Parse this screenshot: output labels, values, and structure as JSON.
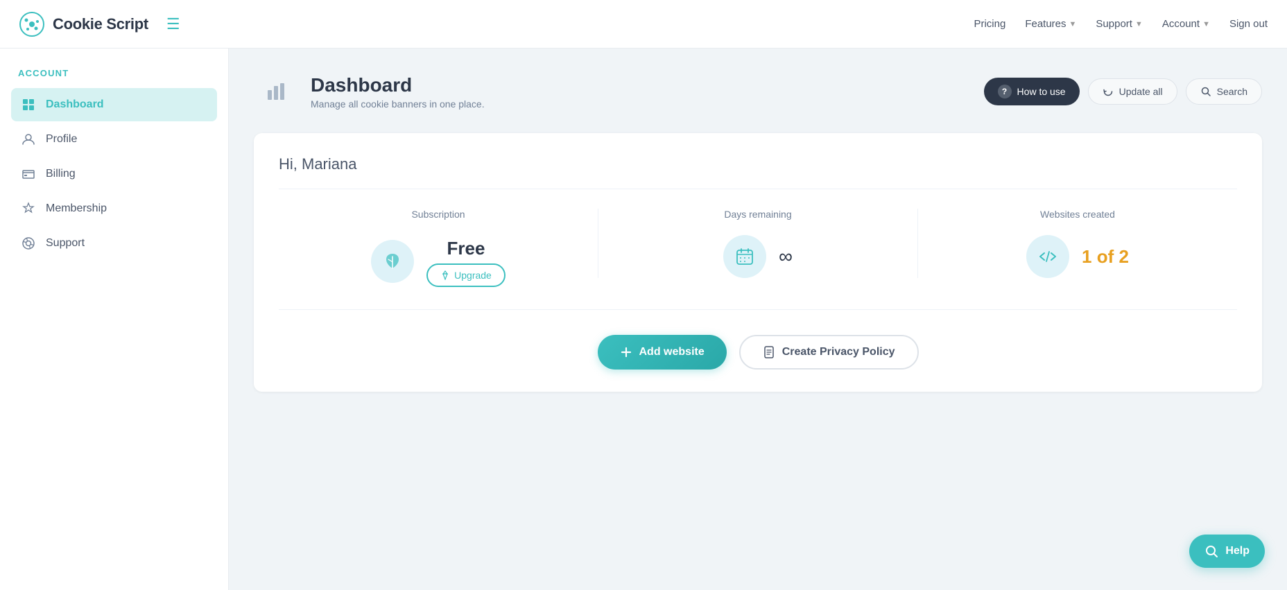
{
  "topnav": {
    "logo_text": "Cookie Script",
    "pricing": "Pricing",
    "features": "Features",
    "support": "Support",
    "account": "Account",
    "sign_out": "Sign out"
  },
  "sidebar": {
    "section_title": "ACCOUNT",
    "items": [
      {
        "id": "dashboard",
        "label": "Dashboard",
        "active": true
      },
      {
        "id": "profile",
        "label": "Profile",
        "active": false
      },
      {
        "id": "billing",
        "label": "Billing",
        "active": false
      },
      {
        "id": "membership",
        "label": "Membership",
        "active": false
      },
      {
        "id": "support",
        "label": "Support",
        "active": false
      }
    ]
  },
  "main": {
    "dashboard_title": "Dashboard",
    "dashboard_subtitle": "Manage all cookie banners in one place.",
    "howto_label": "How to use",
    "update_all_label": "Update all",
    "search_label": "Search",
    "greeting": "Hi, Mariana",
    "subscription_label": "Subscription",
    "subscription_value": "Free",
    "upgrade_label": "Upgrade",
    "days_remaining_label": "Days remaining",
    "days_remaining_value": "∞",
    "websites_label": "Websites created",
    "websites_value": "1 of 2",
    "add_website_label": "Add website",
    "create_policy_label": "Create Privacy Policy",
    "help_label": "Help"
  }
}
